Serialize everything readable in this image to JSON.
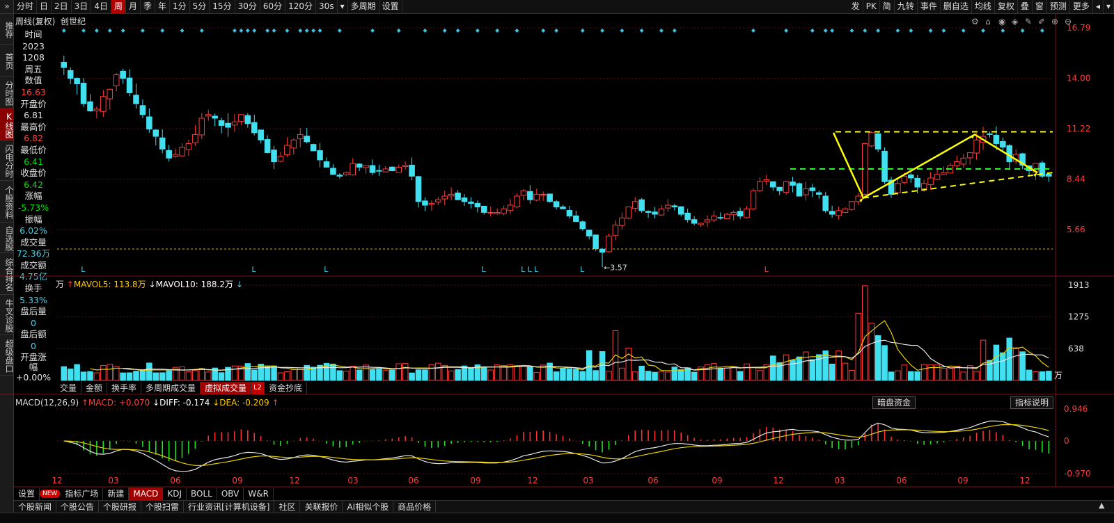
{
  "toolbar": {
    "periods": [
      {
        "label": "分时",
        "active": false
      },
      {
        "label": "日",
        "active": false
      },
      {
        "label": "2日",
        "active": false
      },
      {
        "label": "3日",
        "active": false
      },
      {
        "label": "4日",
        "active": false
      },
      {
        "label": "周",
        "active": true
      },
      {
        "label": "月",
        "active": false
      },
      {
        "label": "季",
        "active": false
      },
      {
        "label": "年",
        "active": false
      },
      {
        "label": "1分",
        "active": false
      },
      {
        "label": "5分",
        "active": false
      },
      {
        "label": "15分",
        "active": false
      },
      {
        "label": "30分",
        "active": false
      },
      {
        "label": "60分",
        "active": false
      },
      {
        "label": "120分",
        "active": false
      },
      {
        "label": "30s",
        "active": false
      }
    ],
    "multi_period": "多周期",
    "settings": "设置",
    "right_items": [
      "发",
      "PK",
      "简",
      "九转",
      "事件",
      "删自选",
      "均线",
      "复权",
      "叠",
      "窗",
      "预测",
      "更多"
    ]
  },
  "sidebar": {
    "top_arrow": "»",
    "items": [
      {
        "label": "推荐",
        "active": false
      },
      {
        "label": "首页",
        "active": false
      },
      {
        "label": "分时图",
        "active": false
      },
      {
        "label": "K线图",
        "active": true
      },
      {
        "label": "闪电分时",
        "active": false
      },
      {
        "label": "个股资料",
        "active": false
      },
      {
        "label": "自选股",
        "active": false
      },
      {
        "label": "综合排名",
        "active": false
      },
      {
        "label": "牛叉诊股",
        "active": false
      },
      {
        "label": "超级盘口",
        "active": false
      }
    ]
  },
  "chart_title": "周线(复权)  创世纪",
  "info": {
    "time_label": "时间",
    "year": "2023",
    "date": "1208",
    "weekday": "周五",
    "value_label": "数值",
    "value": "16.63",
    "open_label": "开盘价",
    "open": "6.81",
    "high_label": "最高价",
    "high": "6.82",
    "low_label": "最低价",
    "low": "6.41",
    "close_label": "收盘价",
    "close": "6.42",
    "change_label": "涨幅",
    "change": "-5.73%",
    "amplitude_label": "振幅",
    "amplitude": "6.02%",
    "volume_label": "成交量",
    "volume": "72.36万",
    "turnover_amt_label": "成交额",
    "turnover_amt": "4.75亿",
    "turnover_rate_label": "换手",
    "turnover_rate": "5.33%",
    "after_vol_label": "盘后量",
    "after_vol": "0",
    "after_amt_label": "盘后额",
    "after_amt": "0",
    "open_chg_label": "开盘涨幅",
    "open_chg": "+0.00%"
  },
  "price_axis": [
    "16.79",
    "14.00",
    "11.22",
    "8.44",
    "5.66"
  ],
  "min_label": "←3.57",
  "l_markers": "L",
  "volume": {
    "unit": "万",
    "mavol5_label": "MAVOL5: 113.8万",
    "mavol10_label": "MAVOL10: 188.2万",
    "axis": [
      "1913",
      "1275",
      "638"
    ],
    "axis_unit": "万"
  },
  "vol_tabs": [
    {
      "label": "交量",
      "active": false
    },
    {
      "label": "金额",
      "active": false
    },
    {
      "label": "换手率",
      "active": false
    },
    {
      "label": "多周期成交量",
      "active": false
    },
    {
      "label": "虚拟成交量",
      "active": true
    },
    {
      "label": "L2",
      "active": false
    },
    {
      "label": "资金抄底",
      "active": false
    }
  ],
  "macd": {
    "title": "MACD(12,26,9)",
    "macd_val": "MACD: +0.070",
    "diff_val": "DIFF: -0.174",
    "dea_val": "DEA: -0.209",
    "axis": [
      "0.946",
      "0",
      "-0.970"
    ],
    "dark_pool_button": "暗盘资金",
    "indicator_help_button": "指标说明"
  },
  "x_axis": [
    "12",
    "03",
    "06",
    "09",
    "12",
    "03",
    "06",
    "09",
    "12",
    "03",
    "06",
    "09",
    "12",
    "03",
    "06",
    "09",
    "12"
  ],
  "bottom_tabs": [
    {
      "label": "设置",
      "active": false
    },
    {
      "label": "NEW",
      "active": false
    },
    {
      "label": "指标广场",
      "active": false
    },
    {
      "label": "新建",
      "active": false
    },
    {
      "label": "MACD",
      "active": true
    },
    {
      "label": "KDJ",
      "active": false
    },
    {
      "label": "BOLL",
      "active": false
    },
    {
      "label": "OBV",
      "active": false
    },
    {
      "label": "W&R",
      "active": false
    }
  ],
  "news_tabs": [
    "个股新闻",
    "个股公告",
    "个股研报",
    "个股扫雷",
    "行业资讯[计算机设备]",
    "社区",
    "关联报价",
    "AI相似个股",
    "商品价格"
  ],
  "colors": {
    "up": "#ff3c3c",
    "down": "#40e0f0",
    "ma_white": "#e8e8e8",
    "ma_yellow": "#e8d000",
    "pattern_yellow": "#ffff00",
    "pattern_green": "#30ff30",
    "accent": "#a00000"
  },
  "chart_data": {
    "type": "candlestick",
    "price_range": [
      3.2,
      16.79
    ],
    "weekly_closes": [
      14.6,
      14.0,
      13.7,
      12.6,
      12.2,
      12.3,
      13.0,
      13.4,
      14.2,
      14.0,
      13.2,
      12.6,
      12.0,
      11.2,
      10.8,
      10.1,
      9.6,
      9.8,
      10.2,
      10.4,
      10.9,
      11.8,
      12.0,
      11.8,
      11.4,
      11.3,
      11.6,
      12.0,
      11.5,
      11.0,
      10.6,
      9.9,
      9.4,
      9.7,
      10.3,
      10.6,
      10.9,
      10.5,
      10.0,
      9.5,
      9.1,
      8.7,
      8.6,
      8.8,
      9.3,
      9.1,
      9.2,
      8.8,
      8.9,
      9.0,
      8.9,
      9.1,
      9.2,
      8.6,
      7.2,
      7.0,
      7.1,
      7.3,
      7.5,
      7.6,
      7.3,
      7.2,
      7.1,
      6.9,
      6.6,
      6.6,
      6.6,
      6.8,
      7.0,
      7.5,
      7.8,
      7.3,
      7.6,
      7.6,
      7.2,
      6.9,
      6.8,
      6.4,
      6.1,
      5.7,
      5.3,
      4.6,
      4.4,
      5.3,
      5.9,
      6.3,
      6.9,
      7.2,
      6.7,
      6.6,
      6.5,
      6.8,
      7.0,
      6.9,
      6.5,
      6.2,
      6.0,
      6.0,
      6.2,
      6.4,
      6.3,
      6.5,
      6.6,
      6.4,
      6.8,
      7.8,
      8.3,
      8.4,
      8.0,
      7.8,
      8.3,
      8.1,
      7.5,
      7.9,
      7.8,
      7.6,
      6.7,
      6.5,
      6.7,
      6.8,
      7.2,
      7.5,
      10.4,
      11.0,
      10.1,
      8.3,
      7.6,
      8.2,
      8.6,
      8.5,
      8.0,
      8.2,
      8.5,
      8.7,
      8.8,
      9.2,
      9.4,
      9.6,
      9.9,
      10.6,
      10.8,
      10.9,
      10.4,
      10.2,
      9.4,
      9.8,
      9.2,
      8.9,
      9.3,
      8.6,
      8.6
    ],
    "series": [
      {
        "name": "MAVOL5",
        "value": "113.8万"
      },
      {
        "name": "MAVOL10",
        "value": "188.2万"
      }
    ],
    "annotations": [
      "min 3.57"
    ]
  }
}
